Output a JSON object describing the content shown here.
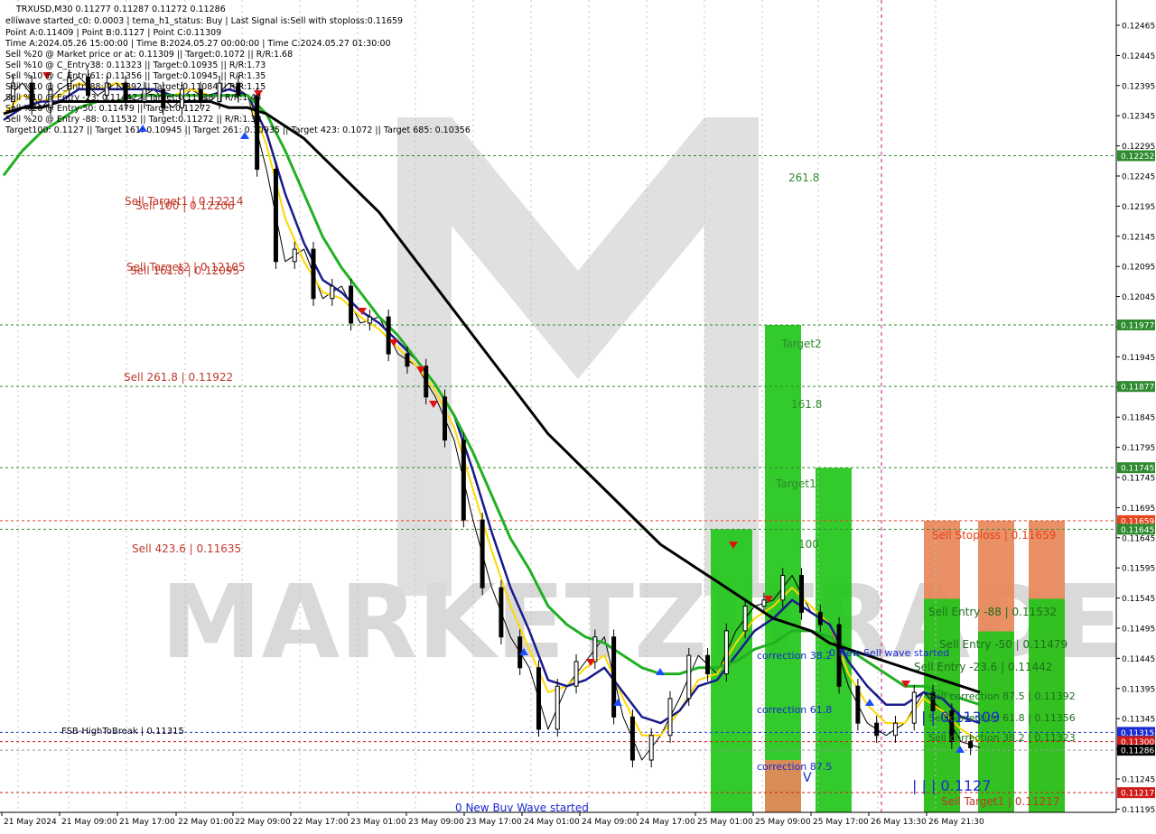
{
  "header": {
    "lines": [
      "TRXUSD,M30  0.11277 0.11287 0.11272 0.11286",
      "elliwave started_c0: 0.0003 | tema_h1_status: Buy | Last Signal is:Sell with stoploss:0.11659",
      "Point A:0.11409 | Point B:0.1127 | Point C:0.11309",
      "Time A:2024.05.26 15:00:00 | Time B:2024.05.27 00:00:00 | Time C:2024.05.27 01:30:00",
      "Sell %20 @ Market price or at: 0.11309 || Target:0.1072 || R/R:1.68",
      "Sell %10 @ C_Entry38: 0.11323 || Target:0.10935 || R/R:1.73",
      "Sell %10 @ C_Entry61: 0.11356 || Target:0.10945 || R/R:1.35",
      "Sell %10 @ C_Entry88: 0.11392 || Target:0.11084 || R/R:1.15",
      "Sell %10 @ Entry -23: 0.11442 || Target:0.11138 || R/R:1.43",
      "Sell %20 @ Entry-50: 0.11479 || Target:0.11272",
      "Sell %20 @ Entry -88: 0.11532 || Target:0.11272 || R/R:1.38",
      "Target100: 0.1127 || Target 161: 0.10945 || Target 261: 0.10935 || Target 423: 0.1072 || Target 685: 0.10356"
    ]
  },
  "axis": {
    "y_ticks": [
      "0.12465",
      "0.12445",
      "0.12395",
      "0.12345",
      "0.12295",
      "0.12245",
      "0.12195",
      "0.12145",
      "0.12095",
      "0.12045",
      "0.11995",
      "0.11945",
      "0.11895",
      "0.11845",
      "0.11795",
      "0.11745",
      "0.11695",
      "0.11645",
      "0.11595",
      "0.11545",
      "0.11495",
      "0.11445",
      "0.11395",
      "0.11345",
      "0.11295",
      "0.11245",
      "0.11195"
    ],
    "x_ticks": [
      "21 May 2024",
      "21 May 09:00",
      "21 May 17:00",
      "22 May 01:00",
      "22 May 09:00",
      "22 May 17:00",
      "23 May 01:00",
      "23 May 09:00",
      "23 May 17:00",
      "24 May 01:00",
      "24 May 09:00",
      "24 May 17:00",
      "25 May 01:00",
      "25 May 09:00",
      "25 May 17:00",
      "26 May 13:30",
      "26 May 21:30"
    ],
    "price_tags": [
      {
        "label": "0.12252",
        "price": 0.12252,
        "color": "#2e8b2e"
      },
      {
        "label": "0.11977",
        "price": 0.11977,
        "color": "#2e8b2e"
      },
      {
        "label": "0.11877",
        "price": 0.11877,
        "color": "#2e8b2e"
      },
      {
        "label": "0.11745",
        "price": 0.11745,
        "color": "#2e8b2e"
      },
      {
        "label": "0.11659",
        "price": 0.11659,
        "color": "#e8431c"
      },
      {
        "label": "0.11645",
        "price": 0.11645,
        "color": "#2e8b2e"
      },
      {
        "label": "0.11315",
        "price": 0.11315,
        "color": "#1a2bd1"
      },
      {
        "label": "0.11300",
        "price": 0.113,
        "color": "#d11a1a"
      },
      {
        "label": "0.11286",
        "price": 0.11286,
        "color": "#000000"
      },
      {
        "label": "0.11217",
        "price": 0.11217,
        "color": "#d11a1a"
      }
    ]
  },
  "levels": [
    {
      "price": 0.12252,
      "color": "#2e8b2e"
    },
    {
      "price": 0.11977,
      "color": "#2e8b2e"
    },
    {
      "price": 0.11877,
      "color": "#2e8b2e"
    },
    {
      "price": 0.11745,
      "color": "#2e8b2e"
    },
    {
      "price": 0.11659,
      "color": "#e8431c"
    },
    {
      "price": 0.11645,
      "color": "#2e8b2e"
    },
    {
      "price": 0.11315,
      "color": "#1a2bd1"
    },
    {
      "price": 0.113,
      "color": "#d11a1a"
    },
    {
      "price": 0.11286,
      "color": "#999999"
    },
    {
      "price": 0.11217,
      "color": "#d11a1a"
    }
  ],
  "annotations": [
    {
      "text": "Sell Target1 | 0.12214",
      "color": "#c0392b"
    },
    {
      "text": "Sell 100 | 0.12206",
      "color": "#c0392b"
    },
    {
      "text": "Sell Target2 | 0.12105",
      "color": "#c0392b"
    },
    {
      "text": "Sell 161.8 | 0.12095",
      "color": "#c0392b"
    },
    {
      "text": "Sell 261.8 | 0.11922",
      "color": "#c0392b"
    },
    {
      "text": "Sell 423.6 | 0.11635",
      "color": "#c0392b"
    },
    {
      "text": "FSB-HighToBreak | 0.11315",
      "color": "#000000"
    },
    {
      "text": "0 New Buy Wave started",
      "color": "#1a2bd1"
    },
    {
      "text": "261.8",
      "color": "#2e8b2e"
    },
    {
      "text": "Target2",
      "color": "#2e8b2e"
    },
    {
      "text": "161.8",
      "color": "#2e8b2e"
    },
    {
      "text": "Target1",
      "color": "#2e8b2e"
    },
    {
      "text": "100",
      "color": "#2e8b2e"
    },
    {
      "text": "Sell Stoploss | 0.11659",
      "color": "#e8431c"
    },
    {
      "text": "Sell Entry -88 | 0.11532",
      "color": "#2e8b2e"
    },
    {
      "text": "Sell Entry -50 | 0.11479",
      "color": "#2e8b2e"
    },
    {
      "text": "Sell Entry -23.6 | 0.11442",
      "color": "#2e8b2e"
    },
    {
      "text": "Sell correction 87.5 | 0.11392",
      "color": "#2e8b2e"
    },
    {
      "text": "Sell correction 61.8 | 0.11356",
      "color": "#2e8b2e"
    },
    {
      "text": "Sell correction 38.2 | 0.11323",
      "color": "#2e8b2e"
    },
    {
      "text": "0 New Sell wave started",
      "color": "#1a2bd1"
    },
    {
      "text": "correction 38.2",
      "color": "#1a2bd1"
    },
    {
      "text": "correction 61.8",
      "color": "#1a2bd1"
    },
    {
      "text": "correction 87.5",
      "color": "#1a2bd1"
    },
    {
      "text": "V",
      "color": "#1a2bd1"
    },
    {
      "text": "| | | 0.1127",
      "color": "#1a2bd1"
    },
    {
      "text": "| | 0.11309",
      "color": "#1a2bd1"
    },
    {
      "text": "Sell Target1 | 0.11217",
      "color": "#c0392b"
    }
  ],
  "watermark": {
    "text": "MARKETZITRADE"
  },
  "colors": {
    "bar_green": "#22c51a",
    "bar_orange": "#e8875a",
    "ema_fast": "#ffd700",
    "ema_mid": "#1a1a8c",
    "ema_slow": "#22b022",
    "ema_long": "#000000",
    "candle": "#000000",
    "arrow_down": "#e01010",
    "arrow_up": "#1a4cff"
  },
  "chart_data": {
    "type": "line",
    "symbol": "TRXUSD",
    "timeframe": "M30",
    "ylim": [
      0.11185,
      0.12505
    ],
    "x_labels": [
      "21 May 2024",
      "21 May 09:00",
      "21 May 17:00",
      "22 May 01:00",
      "22 May 09:00",
      "22 May 17:00",
      "23 May 01:00",
      "23 May 09:00",
      "23 May 17:00",
      "24 May 01:00",
      "24 May 09:00",
      "24 May 17:00",
      "25 May 01:00",
      "25 May 09:00",
      "25 May 17:00",
      "26 May 13:30",
      "26 May 21:30"
    ],
    "series": [
      {
        "role": "price",
        "values": [
          0.1234,
          0.1237,
          0.1233,
          0.1236,
          0.1238,
          0.1235,
          0.1237,
          0.1234,
          0.1236,
          0.1233,
          0.1236,
          0.1234,
          0.1237,
          0.1235,
          0.1223,
          0.1208,
          0.121,
          0.1202,
          0.1204,
          0.1198,
          0.1199,
          0.1193,
          0.1191,
          0.1186,
          0.1179,
          0.1166,
          0.1155,
          0.1147,
          0.1142,
          0.1132,
          0.1139,
          0.1143,
          0.1147,
          0.1134,
          0.1127,
          0.1131,
          0.1137,
          0.1144,
          0.1141,
          0.1148,
          0.1152,
          0.1153,
          0.1157,
          0.1151,
          0.1149,
          0.1139,
          0.1133,
          0.1131,
          0.1133,
          0.1138,
          0.1135,
          0.113,
          0.1129
        ]
      },
      {
        "role": "ema_fast",
        "values": [
          0.1232,
          0.1235,
          0.1234,
          0.1235,
          0.1237,
          0.1236,
          0.1237,
          0.1236,
          0.1236,
          0.1235,
          0.1236,
          0.1235,
          0.1236,
          0.1235,
          0.1227,
          0.1215,
          0.1208,
          0.1203,
          0.1202,
          0.1199,
          0.1197,
          0.1194,
          0.1191,
          0.1187,
          0.1181,
          0.1171,
          0.1161,
          0.1152,
          0.1145,
          0.1138,
          0.1139,
          0.1142,
          0.1144,
          0.1137,
          0.1131,
          0.1131,
          0.1135,
          0.114,
          0.1141,
          0.1146,
          0.115,
          0.1152,
          0.1155,
          0.1152,
          0.1149,
          0.1141,
          0.1136,
          0.1133,
          0.1133,
          0.1137,
          0.1135,
          0.1132,
          0.113
        ]
      },
      {
        "role": "ema_mid",
        "values": [
          0.1231,
          0.1233,
          0.1234,
          0.1234,
          0.1236,
          0.1236,
          0.1236,
          0.1236,
          0.1236,
          0.1235,
          0.1235,
          0.1235,
          0.1236,
          0.1235,
          0.1229,
          0.1219,
          0.1211,
          0.1205,
          0.1203,
          0.12,
          0.1198,
          0.1195,
          0.1192,
          0.1188,
          0.1183,
          0.1174,
          0.1164,
          0.1155,
          0.1148,
          0.114,
          0.1139,
          0.114,
          0.1142,
          0.1138,
          0.1134,
          0.1133,
          0.1135,
          0.1139,
          0.114,
          0.1144,
          0.1148,
          0.115,
          0.1153,
          0.1151,
          0.1149,
          0.1143,
          0.1139,
          0.1136,
          0.1136,
          0.1138,
          0.1137,
          0.1134,
          0.1133
        ]
      },
      {
        "role": "ema_slow",
        "values": [
          0.1222,
          0.1226,
          0.1229,
          0.1231,
          0.1233,
          0.1234,
          0.1234,
          0.1235,
          0.1235,
          0.1235,
          0.1235,
          0.1235,
          0.1235,
          0.1235,
          0.1232,
          0.1226,
          0.1219,
          0.1212,
          0.1207,
          0.1203,
          0.1199,
          0.1196,
          0.1192,
          0.1188,
          0.1183,
          0.1177,
          0.117,
          0.1163,
          0.1158,
          0.1152,
          0.1149,
          0.1147,
          0.1146,
          0.1144,
          0.1142,
          0.1141,
          0.1141,
          0.1142,
          0.1142,
          0.1143,
          0.1145,
          0.1146,
          0.1148,
          0.1148,
          0.1147,
          0.1145,
          0.1143,
          0.1141,
          0.1139,
          0.1139,
          0.1138,
          0.1137,
          0.1136
        ]
      },
      {
        "role": "ema_long",
        "values": [
          0.1232,
          0.1233,
          0.1233,
          0.1234,
          0.1234,
          0.1234,
          0.1234,
          0.1234,
          0.1234,
          0.1234,
          0.1234,
          0.1234,
          0.1233,
          0.1233,
          0.1232,
          0.123,
          0.1228,
          0.1225,
          0.1222,
          0.1219,
          0.1216,
          0.1212,
          0.1208,
          0.1204,
          0.12,
          0.1196,
          0.1192,
          0.1188,
          0.1184,
          0.118,
          0.1177,
          0.1174,
          0.1171,
          0.1168,
          0.1165,
          0.1162,
          0.116,
          0.1158,
          0.1156,
          0.1154,
          0.1152,
          0.115,
          0.1149,
          0.1148,
          0.1146,
          0.1145,
          0.1144,
          0.1143,
          0.1142,
          0.1141,
          0.114,
          0.1139,
          0.1138
        ]
      }
    ]
  }
}
